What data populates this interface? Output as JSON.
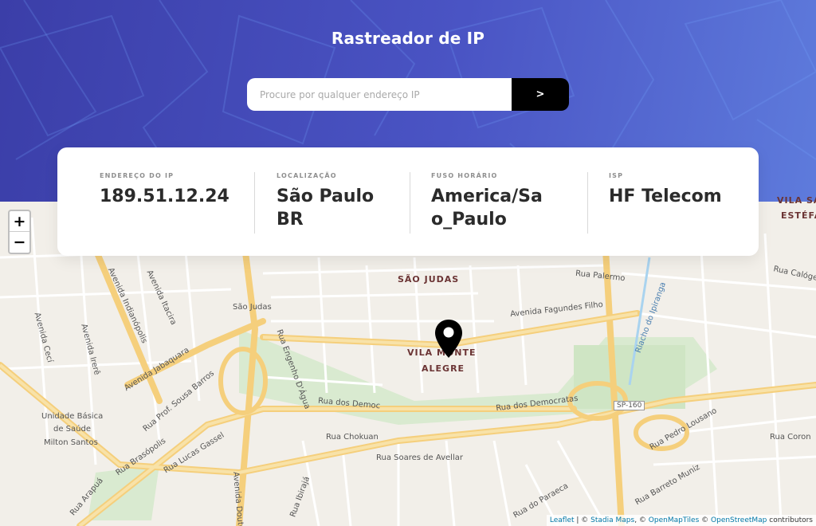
{
  "header": {
    "title": "Rastreador de IP",
    "search_placeholder": "Procure por qualquer endereço IP",
    "submit_label": ">"
  },
  "info": {
    "ip": {
      "label": "ENDEREÇO DO IP",
      "value": "189.51.12.24"
    },
    "location": {
      "label": "LOCALIZAÇÃO",
      "value": "São Paulo BR"
    },
    "timezone": {
      "label": "FUSO HORÁRIO",
      "value": "America/Sao_Paulo"
    },
    "isp": {
      "label": "ISP",
      "value": "HF Telecom"
    }
  },
  "map": {
    "zoom_in": "+",
    "zoom_out": "−",
    "labels": {
      "sao_judas_area": "SÃO JUDAS",
      "vila_monte_alegre_1": "VILA MONTE",
      "vila_monte_alegre_2": "ALEGRE",
      "vila_estefania_1": "VILA SAN",
      "vila_estefania_2": "ESTÉFA",
      "sao_judas_station": "São Judas",
      "av_fagundes": "Avenida Fagundes Filho",
      "rua_palermo": "Rua Palermo",
      "rua_democ_1": "Rua dos Democ",
      "rua_democ_2": "Rua dos Democratas",
      "rua_chokuan": "Rua Chokuan",
      "rua_soares": "Rua Soares de Avellar",
      "av_jabaquara": "Avenida Jabaquara",
      "av_indianopolis": "Avenida Indianópolis",
      "av_itacira": "Avenida Itacira",
      "av_cecí": "Avenida Cecí",
      "av_irere": "Avenida Irerê",
      "ubs_1": "Unidade Básica",
      "ubs_2": "de Saúde",
      "ubs_3": "Milton Santos",
      "sp160": "SP-160",
      "rua_pedro": "Rua Pedro Lousano",
      "rua_coron": "Rua Coron",
      "rua_barreto": "Rua Barreto Muniz",
      "rua_calogero": "Rua Calóge",
      "riacho": "Riacho do Ipiranga",
      "rua_engenho": "Rua Engenho D'Água",
      "rua_sousa_barros": "Rua Prof. Sousa Barros",
      "rua_brasopolis": "Rua Brasópolis",
      "rua_lucas": "Rua Lucas Gassel",
      "rua_arapua": "Rua Arapuá",
      "rua_paraeca": "Rua do Paraeca",
      "rua_ibiraja": "Rua Ibirajá",
      "av_dout": "Avenida Douto"
    },
    "attribution": {
      "leaflet": "Leaflet",
      "sep1": " | © ",
      "stadia": "Stadia Maps",
      "sep2": ", © ",
      "omt": "OpenMapTiles",
      "sep3": " © ",
      "osm": "OpenStreetMap",
      "tail": " contributors"
    }
  }
}
